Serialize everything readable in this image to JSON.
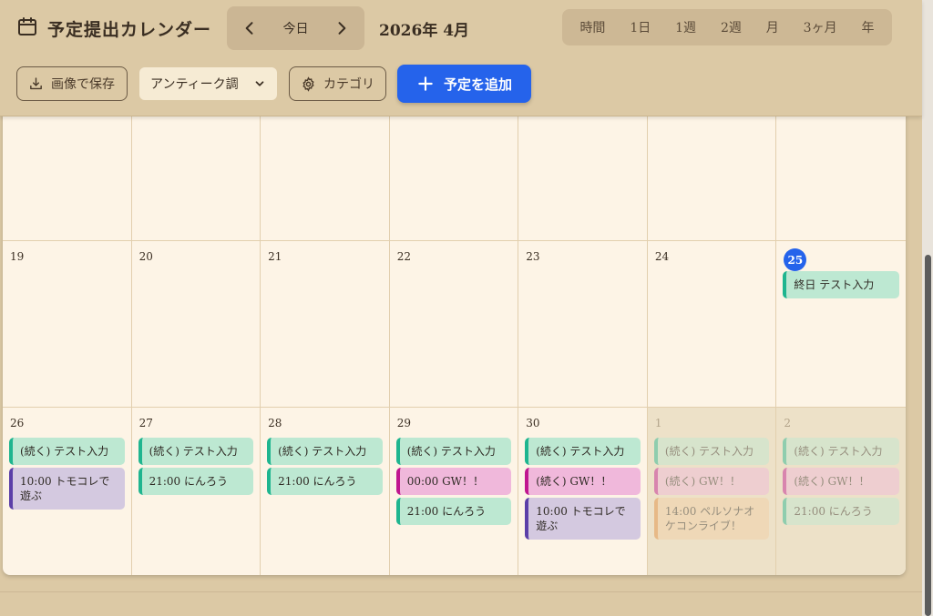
{
  "header": {
    "title": "予定提出カレンダー",
    "today_label": "今日",
    "month_label": "2026年 4月",
    "views": [
      "時間",
      "1日",
      "1週",
      "2週",
      "月",
      "3ヶ月",
      "年"
    ],
    "save_image_label": "画像で保存",
    "theme_select_value": "アンティーク調",
    "category_label": "カテゴリ",
    "add_event_label": "予定を追加"
  },
  "calendar": {
    "weeks": [
      {
        "days": [
          {
            "num": "",
            "events": []
          },
          {
            "num": "",
            "events": []
          },
          {
            "num": "",
            "events": []
          },
          {
            "num": "",
            "events": []
          },
          {
            "num": "",
            "events": []
          },
          {
            "num": "",
            "events": []
          },
          {
            "num": "",
            "events": []
          }
        ]
      },
      {
        "days": [
          {
            "num": "19",
            "events": []
          },
          {
            "num": "20",
            "events": []
          },
          {
            "num": "21",
            "events": []
          },
          {
            "num": "22",
            "events": []
          },
          {
            "num": "23",
            "events": []
          },
          {
            "num": "24",
            "events": []
          },
          {
            "num": "25",
            "today": true,
            "events": [
              {
                "text": "終日 テスト入力",
                "color": "teal"
              }
            ]
          }
        ]
      },
      {
        "days": [
          {
            "num": "26",
            "events": [
              {
                "text": "(続く) テスト入力",
                "color": "teal"
              },
              {
                "text": "10:00 トモコレで遊ぶ",
                "color": "purple"
              }
            ]
          },
          {
            "num": "27",
            "events": [
              {
                "text": "(続く) テスト入力",
                "color": "teal"
              },
              {
                "text": "21:00 にんろう",
                "color": "teal"
              }
            ]
          },
          {
            "num": "28",
            "events": [
              {
                "text": "(続く) テスト入力",
                "color": "teal"
              },
              {
                "text": "21:00 にんろう",
                "color": "teal"
              }
            ]
          },
          {
            "num": "29",
            "events": [
              {
                "text": "(続く) テスト入力",
                "color": "teal"
              },
              {
                "text": "00:00 GW！！",
                "color": "pink"
              },
              {
                "text": "21:00 にんろう",
                "color": "teal"
              }
            ]
          },
          {
            "num": "30",
            "events": [
              {
                "text": "(続く) テスト入力",
                "color": "teal"
              },
              {
                "text": "(続く) GW！！",
                "color": "pink"
              },
              {
                "text": "10:00 トモコレで遊ぶ",
                "color": "purple"
              }
            ]
          },
          {
            "num": "1",
            "other": true,
            "events": [
              {
                "text": "(続く) テスト入力",
                "color": "teal"
              },
              {
                "text": "(続く) GW！！",
                "color": "pink"
              },
              {
                "text": "14:00 ペルソナオケコンライブ！",
                "color": "orange"
              }
            ]
          },
          {
            "num": "2",
            "other": true,
            "events": [
              {
                "text": "(続く) テスト入力",
                "color": "teal"
              },
              {
                "text": "(続く) GW！！",
                "color": "pink"
              },
              {
                "text": "21:00 にんろう",
                "color": "teal"
              }
            ]
          }
        ]
      }
    ]
  },
  "colors": {
    "accent": "#2563eb",
    "teal": "#1fb58f",
    "pink": "#c0168f",
    "purple": "#5b3fa8",
    "orange": "#e08a3a"
  }
}
